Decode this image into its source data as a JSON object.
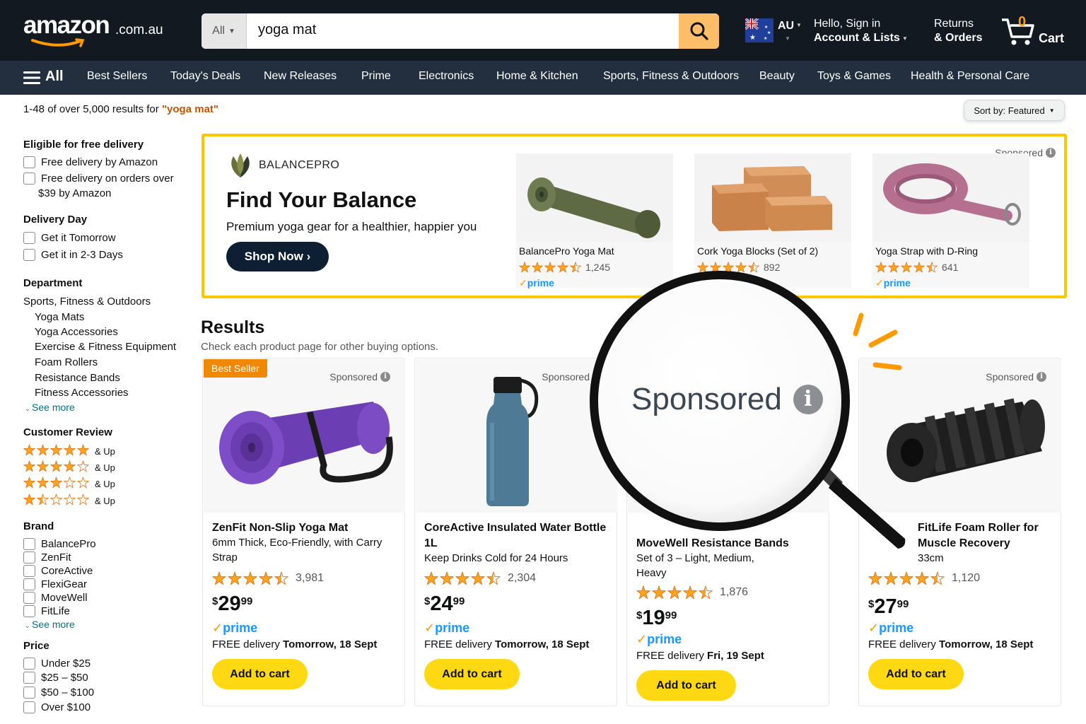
{
  "header": {
    "logo_text": "amazon",
    "logo_tld": ".com.au",
    "search_category": "All",
    "search_value": "yoga mat",
    "region": "AU",
    "greeting": "Hello, Sign in",
    "account_label": "Account & Lists",
    "returns_line1": "Returns",
    "returns_line2": "& Orders",
    "cart_count": "0",
    "cart_label": "Cart"
  },
  "nav": {
    "all_label": "All",
    "items": [
      "Best Sellers",
      "Today's Deals",
      "New Releases",
      "Prime",
      "Electronics",
      "Home & Kitchen",
      "Sports, Fitness & Outdoors",
      "Beauty",
      "Toys & Games",
      "Health & Personal Care"
    ]
  },
  "results_bar": {
    "count_text": "1-48 of over 5,000 results for ",
    "query": "\"yoga mat\"",
    "sort_label": "Sort by: Featured"
  },
  "filters": {
    "free_delivery": {
      "title": "Eligible for free delivery",
      "options": [
        "Free delivery by Amazon",
        "Free delivery on orders over",
        "$39 by Amazon"
      ]
    },
    "delivery_day": {
      "title": "Delivery Day",
      "options": [
        "Get it Tomorrow",
        "Get it in 2-3 Days"
      ]
    },
    "department": {
      "title": "Department",
      "parent": "Sports, Fitness & Outdoors",
      "children": [
        "Yoga Mats",
        "Yoga Accessories",
        "Exercise & Fitness Equipment",
        "Foam Rollers",
        "Resistance Bands",
        "Fitness Accessories"
      ],
      "see_more": "See more"
    },
    "customer_review": {
      "title": "Customer Review",
      "rows": [
        {
          "stars": 5,
          "label": "& Up"
        },
        {
          "stars": 4,
          "label": "& Up"
        },
        {
          "stars": 3,
          "label": "& Up"
        },
        {
          "stars": 1.5,
          "label": "& Up"
        }
      ]
    },
    "brand": {
      "title": "Brand",
      "options": [
        "BalancePro",
        "ZenFit",
        "CoreActive",
        "FlexiGear",
        "MoveWell",
        "FitLife"
      ],
      "see_more": "See more"
    },
    "price": {
      "title": "Price",
      "options": [
        "Under $25",
        "$25 – $50",
        "$50 – $100",
        "Over $100"
      ]
    }
  },
  "banner": {
    "brand": "BALANCEPRO",
    "headline": "Find Your Balance",
    "tagline": "Premium yoga gear for a healthier, happier you",
    "cta": "Shop Now ›",
    "sponsored": "Sponsored",
    "products": [
      {
        "name": "BalancePro Yoga Mat",
        "rating": 4.5,
        "reviews": "1,245",
        "prime": "prime"
      },
      {
        "name": "Cork Yoga Blocks (Set of 2)",
        "rating": 4.5,
        "reviews": "892",
        "prime": ""
      },
      {
        "name": "Yoga Strap with D-Ring",
        "rating": 4.5,
        "reviews": "641",
        "prime": "prime"
      }
    ]
  },
  "results": {
    "title": "Results",
    "subtitle": "Check each product page for other buying options."
  },
  "magnifier": {
    "text": "Sponsored"
  },
  "products": [
    {
      "badge": "Best Seller",
      "sponsored": "Sponsored",
      "title": "ZenFit Non-Slip Yoga Mat",
      "subtitle": "6mm Thick, Eco-Friendly, with Carry Strap",
      "rating": 4.5,
      "reviews": "3,981",
      "currency": "$",
      "price_whole": "29",
      "price_frac": "99",
      "prime": "prime",
      "delivery_prefix": "FREE delivery ",
      "delivery_date": "Tomorrow, 18 Sept",
      "button": "Add to cart"
    },
    {
      "badge": "",
      "sponsored": "Sponsored",
      "title": "CoreActive Insulated Water Bottle 1L",
      "subtitle": "Keep Drinks Cold for 24 Hours",
      "rating": 4.5,
      "reviews": "2,304",
      "currency": "$",
      "price_whole": "24",
      "price_frac": "99",
      "prime": "prime",
      "delivery_prefix": "FREE delivery ",
      "delivery_date": "Tomorrow, 18 Sept",
      "button": "Add to cart"
    },
    {
      "badge": "",
      "sponsored": "",
      "title": "MoveWell Resistance Bands",
      "subtitle": "Set of 3 – Light, Medium, Heavy",
      "rating": 4.5,
      "reviews": "1,876",
      "currency": "$",
      "price_whole": "19",
      "price_frac": "99",
      "prime": "prime",
      "delivery_prefix": "FREE delivery ",
      "delivery_date": "Fri, 19 Sept",
      "button": "Add to cart"
    },
    {
      "badge": "",
      "sponsored": "Sponsored",
      "title": "FitLife Foam Roller for Muscle Recovery",
      "subtitle": "33cm",
      "rating": 4.5,
      "reviews": "1,120",
      "currency": "$",
      "price_whole": "27",
      "price_frac": "99",
      "prime": "prime",
      "delivery_prefix": "FREE delivery ",
      "delivery_date": "Tomorrow, 18 Sept",
      "button": "Add to cart"
    }
  ],
  "colors": {
    "header": "#131921",
    "nav": "#232f3e",
    "accent": "#ff9900",
    "search_button": "#febd69",
    "cart_button": "#ffd814",
    "banner_border": "#f7ca00",
    "link": "#007185",
    "badge": "#f08804",
    "prime": "#1a98ff"
  },
  "icons": [
    "menu-icon",
    "search-icon",
    "cart-icon",
    "flag-icon",
    "info-icon",
    "star-icon",
    "magnifier-glass"
  ]
}
